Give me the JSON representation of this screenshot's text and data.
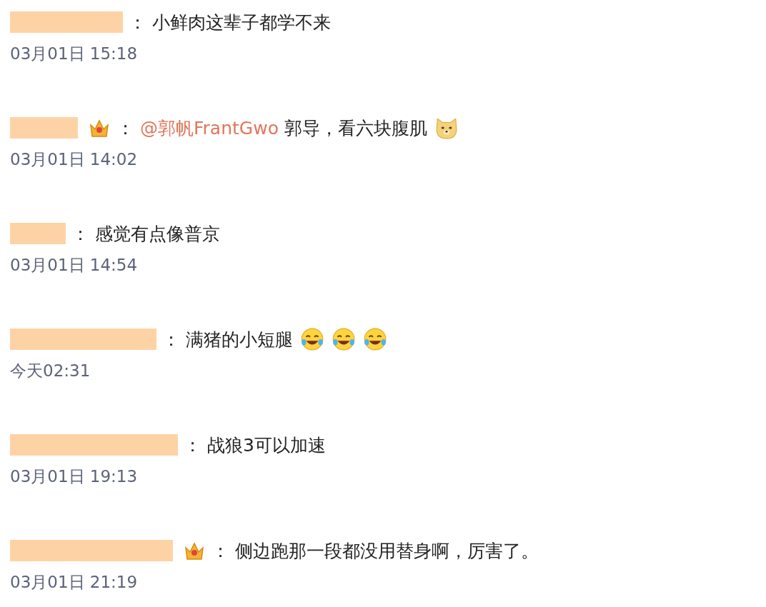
{
  "comments": [
    {
      "badge": false,
      "separator": "：",
      "segments": [
        {
          "kind": "text",
          "text": "小鲜肉这辈子都学不来"
        }
      ],
      "time": "03月01日 15:18"
    },
    {
      "badge": true,
      "separator": "：",
      "segments": [
        {
          "kind": "mention",
          "text": "@郭帆FrantGwo"
        },
        {
          "kind": "text",
          "text": "郭导，看六块腹肌"
        },
        {
          "kind": "emoji_dog"
        }
      ],
      "time": "03月01日 14:02"
    },
    {
      "badge": false,
      "separator": "：",
      "segments": [
        {
          "kind": "text",
          "text": "感觉有点像普京"
        }
      ],
      "time": "03月01日 14:54"
    },
    {
      "badge": false,
      "separator": "：",
      "segments": [
        {
          "kind": "text",
          "text": "满猪的小短腿"
        },
        {
          "kind": "emoji_laugh"
        },
        {
          "kind": "emoji_laugh"
        },
        {
          "kind": "emoji_laugh"
        }
      ],
      "time": "今天02:31"
    },
    {
      "badge": false,
      "separator": "：",
      "segments": [
        {
          "kind": "text",
          "text": "战狼3可以加速"
        }
      ],
      "time": "03月01日 19:13"
    },
    {
      "badge": true,
      "separator": "：",
      "segments": [
        {
          "kind": "text",
          "text": "侧边跑那一段都没用替身啊，厉害了。"
        }
      ],
      "time": "03月01日 21:19"
    }
  ]
}
